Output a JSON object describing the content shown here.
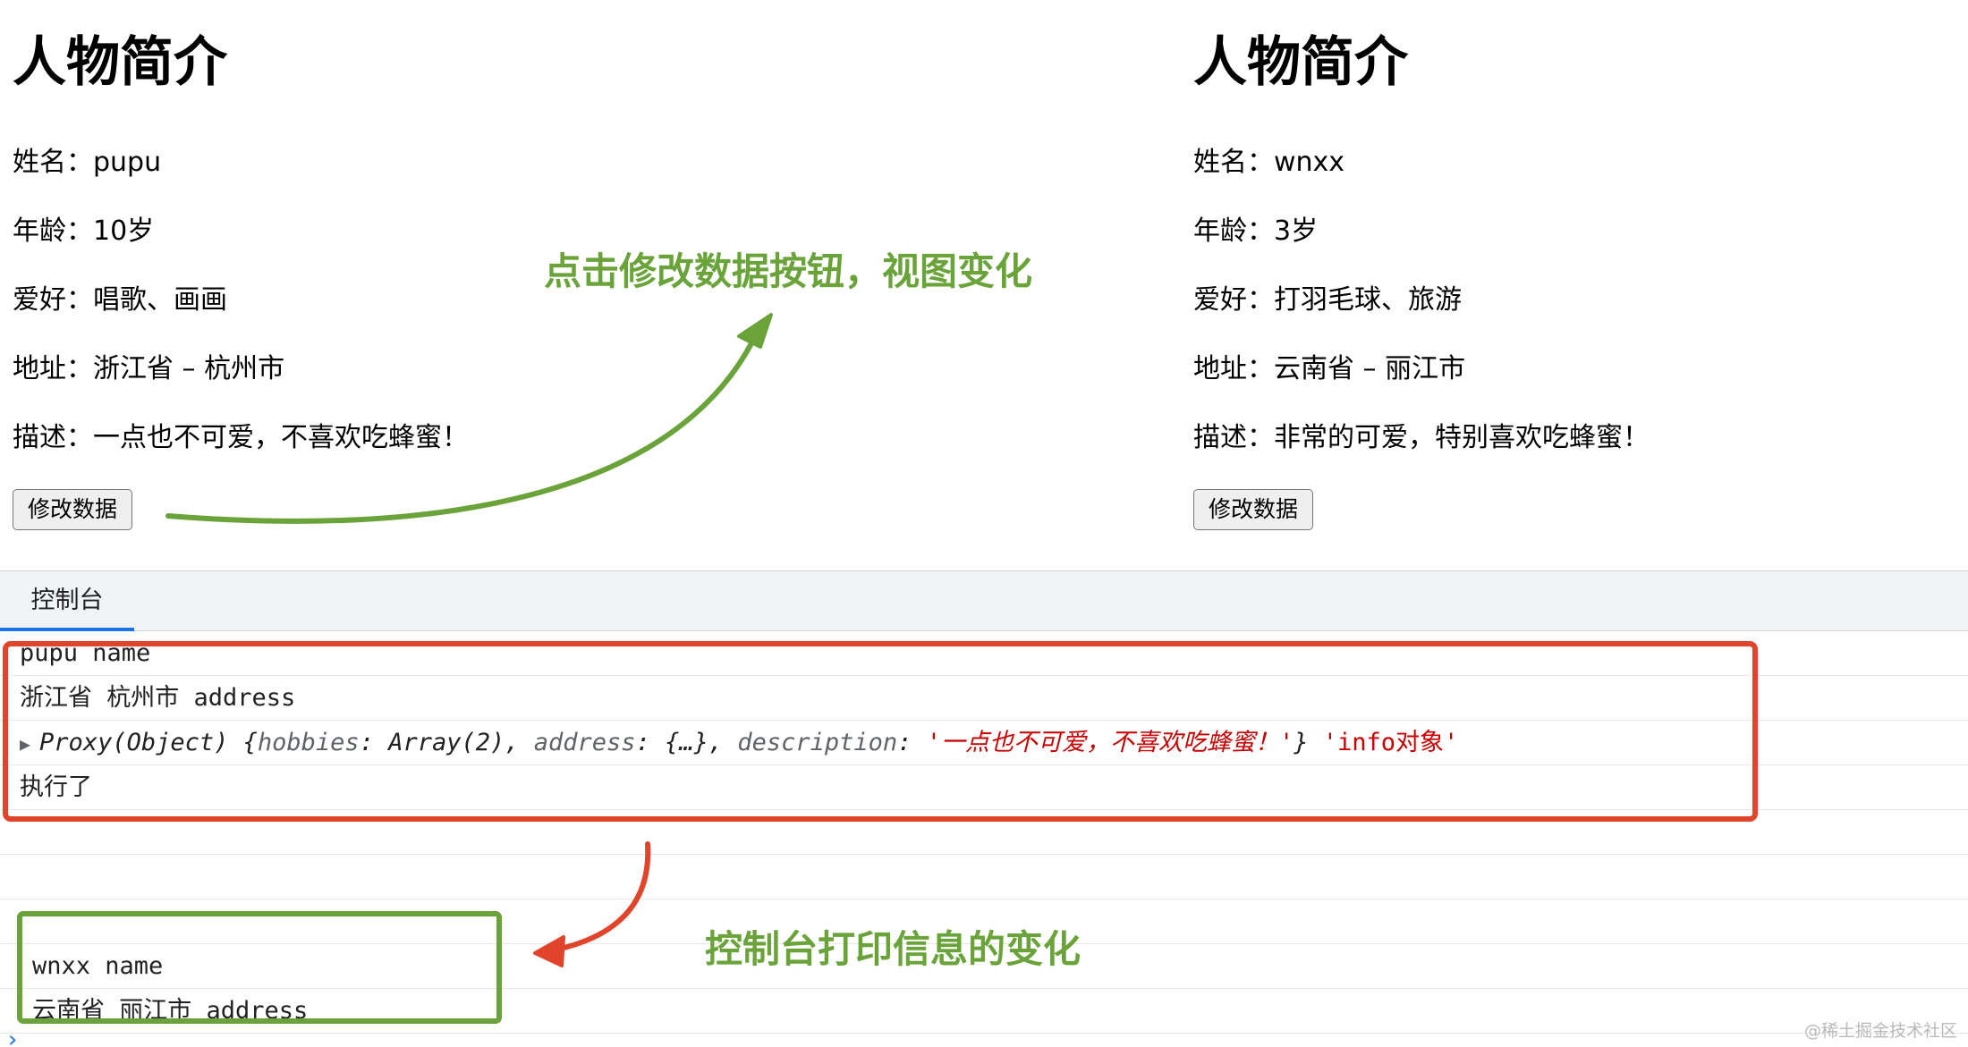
{
  "left_panel": {
    "title": "人物简介",
    "name": "姓名：pupu",
    "age": "年龄：10岁",
    "hobbies": "爱好：唱歌、画画",
    "address": "地址：浙江省 – 杭州市",
    "description": "描述：一点也不可爱，不喜欢吃蜂蜜！",
    "button_label": "修改数据"
  },
  "right_panel": {
    "title": "人物简介",
    "name": "姓名：wnxx",
    "age": "年龄：3岁",
    "hobbies": "爱好：打羽毛球、旅游",
    "address": "地址：云南省 – 丽江市",
    "description": "描述：非常的可爱，特别喜欢吃蜂蜜！",
    "button_label": "修改数据"
  },
  "console": {
    "tab_label": "控制台",
    "line1": "pupu name",
    "line2": "浙江省 杭州市 address",
    "line3": {
      "expand_glyph": "▶",
      "prefix": "Proxy(Object) {",
      "key1": "hobbies",
      "sep1": ": Array(2), ",
      "key2": "address",
      "sep2": ": {…}, ",
      "key3": "description",
      "sep3": ": ",
      "val3": "'一点也不可爱，不喜欢吃蜂蜜！'",
      "suffix": "} ",
      "tag": "'info对象'"
    },
    "line4": "执行了",
    "line5": "wnxx name",
    "line6": "云南省 丽江市 address",
    "prompt_glyph": "›"
  },
  "annotations": {
    "top_note": "点击修改数据按钮，视图变化",
    "bottom_note": "控制台打印信息的变化",
    "watermark": "@稀土掘金技术社区"
  },
  "colors": {
    "annotation_green": "#6aa33a",
    "annotation_red": "#e0442a",
    "console_string_red": "#c80000",
    "tab_blue": "#1a73e8"
  },
  "icons": {
    "expand": "triangle-right-icon",
    "prompt": "chevron-right-icon"
  }
}
